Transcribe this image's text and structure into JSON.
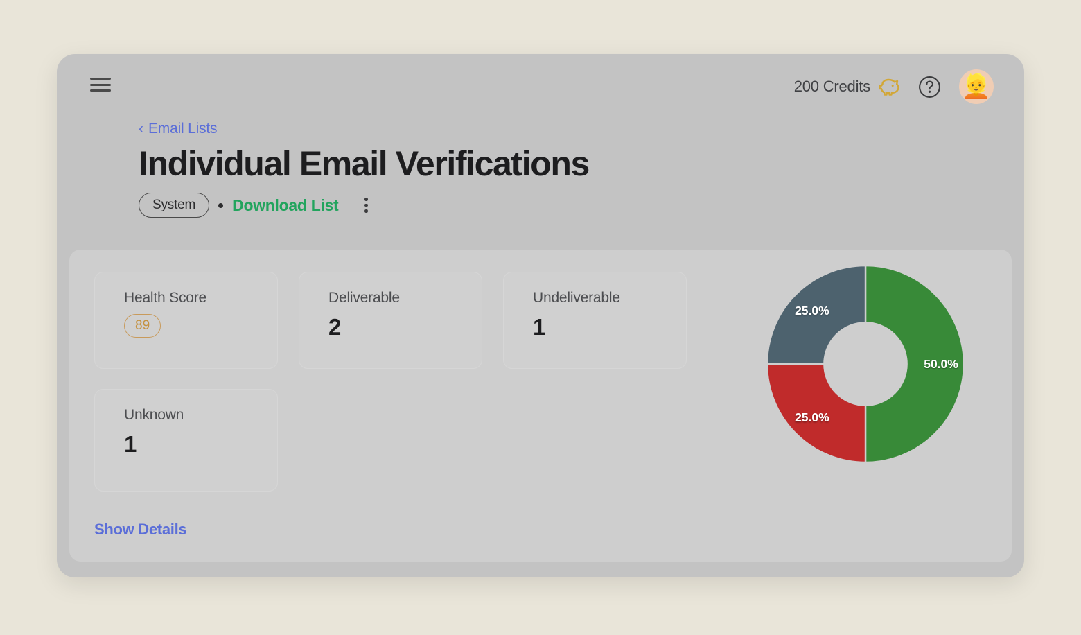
{
  "colors": {
    "page_background": "#e9e5d9",
    "window_background": "#c3c3c3",
    "panel_background": "#cecece",
    "card_background": "#d0d0d0",
    "link_blue": "#5b6ed8",
    "action_green": "#22a45d",
    "score_amber": "#c4913f",
    "credits_gold": "#d2a737",
    "deliverable_green": "#388a38",
    "undeliverable_red": "#c02b2b",
    "unknown_slate": "#4d626e"
  },
  "topbar": {
    "menu_icon": "hamburger-menu-icon",
    "credits_label": "200 Credits",
    "credits_icon": "piggy-bank-icon",
    "help_icon": "help-circle-icon",
    "avatar_icon": "user-avatar",
    "avatar_glyph": "👱"
  },
  "header": {
    "breadcrumb_chevron": "‹",
    "breadcrumb_label": "Email Lists",
    "title": "Individual Email Verifications",
    "source_pill": "System",
    "separator_dot": "•",
    "download_label": "Download List",
    "more_icon": "kebab-menu-icon"
  },
  "stats": [
    {
      "label": "Health Score",
      "value": "89",
      "kind": "badge"
    },
    {
      "label": "Deliverable",
      "value": "2",
      "kind": "number"
    },
    {
      "label": "Undeliverable",
      "value": "1",
      "kind": "number"
    },
    {
      "label": "Unknown",
      "value": "1",
      "kind": "number"
    }
  ],
  "footer": {
    "show_details_label": "Show Details"
  },
  "chart_data": {
    "type": "pie",
    "variant": "donut",
    "title": "",
    "categories": [
      "Deliverable",
      "Undeliverable",
      "Unknown"
    ],
    "values": [
      50.0,
      25.0,
      25.0
    ],
    "counts": [
      2,
      1,
      1
    ],
    "labels": [
      "50.0%",
      "25.0%",
      "25.0%"
    ],
    "colors": [
      "#388a38",
      "#c02b2b",
      "#4d626e"
    ],
    "start_angle_deg": 0,
    "direction": "clockwise",
    "inner_radius_ratio": 0.42,
    "legend": "none",
    "grid": false,
    "label_color": "#ffffff",
    "slice_gap_color": "#cecece"
  }
}
